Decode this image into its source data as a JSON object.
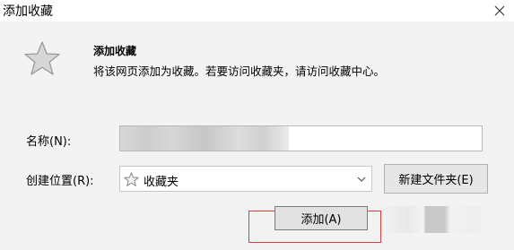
{
  "window": {
    "title": "添加收藏",
    "close_icon": "close-icon"
  },
  "header": {
    "icon": "star-icon",
    "title": "添加收藏",
    "description": "将该网页添加为收藏。若要访问收藏夹，请访问收藏中心。"
  },
  "form": {
    "name_label": "名称(N):",
    "name_value": "",
    "location_label": "创建位置(R):",
    "location_icon": "star-icon",
    "location_value": "收藏夹",
    "dropdown_icon": "chevron-down-icon",
    "new_folder_label": "新建文件夹(E)"
  },
  "buttons": {
    "add_label": "添加(A)"
  },
  "colors": {
    "panel_bg": "#f3f3f3",
    "highlight": "#e53b3b",
    "star_fill": "#d6d6d6",
    "star_stroke": "#9a9a9a"
  }
}
